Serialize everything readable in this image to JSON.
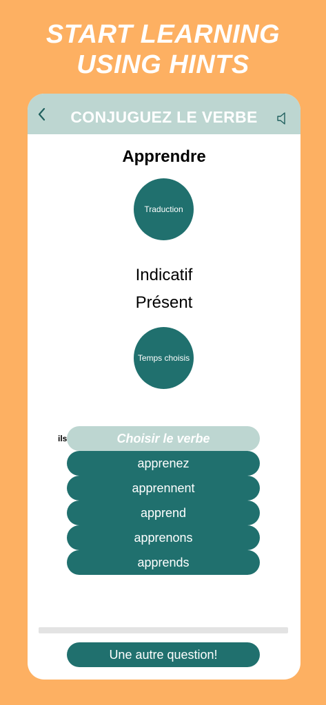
{
  "headline": {
    "line1": "START LEARNING",
    "line2": "USING HINTS"
  },
  "header": {
    "title": "CONJUGUEZ LE VERBE",
    "back_icon": "chevron-left-icon",
    "sound_icon": "speaker-icon"
  },
  "exercise": {
    "verb": "Apprendre",
    "translation_label": "Traduction",
    "mode": "Indicatif",
    "tense": "Présent",
    "tense_button_label": "Temps choisis",
    "pronoun": "ils",
    "choose_label": "Choisir le verbe",
    "options": [
      "apprenez",
      "apprennent",
      "apprend",
      "apprenons",
      "apprends"
    ]
  },
  "progress": {
    "value": 0
  },
  "footer": {
    "next_label": "Une autre question!"
  },
  "colors": {
    "background": "#FDB062",
    "accent": "#20706E",
    "light_accent": "#BDD6D1"
  }
}
